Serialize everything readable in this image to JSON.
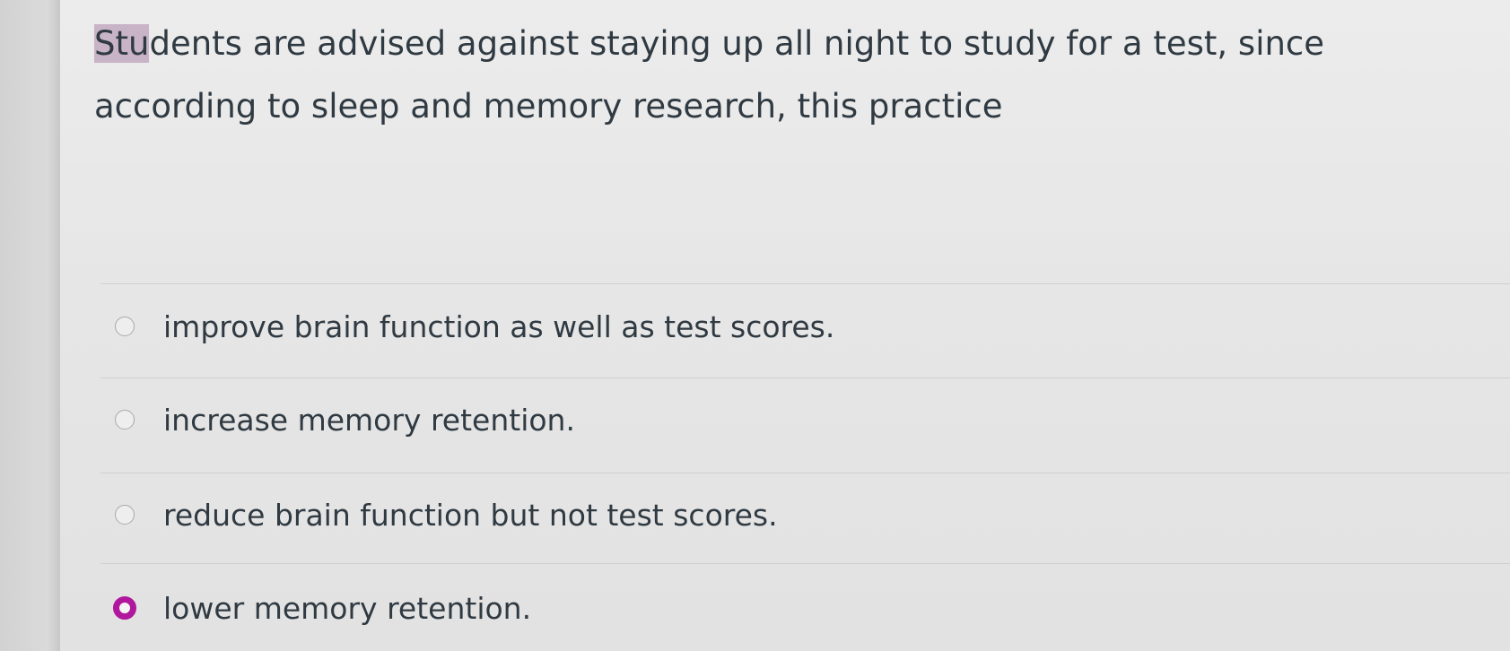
{
  "question": {
    "text_highlight": "Stu",
    "text_rest": "dents are advised against staying up all night to study for a test, since according to sleep and memory research, this practice"
  },
  "answers": [
    {
      "label": "improve brain function as well as test scores.",
      "selected": false
    },
    {
      "label": "increase memory retention.",
      "selected": false
    },
    {
      "label": "reduce brain function but not test scores.",
      "selected": false
    },
    {
      "label": "lower memory retention.",
      "selected": true
    }
  ],
  "colors": {
    "selected_radio": "#b0179d",
    "text_highlight": "#c9b3c7"
  }
}
